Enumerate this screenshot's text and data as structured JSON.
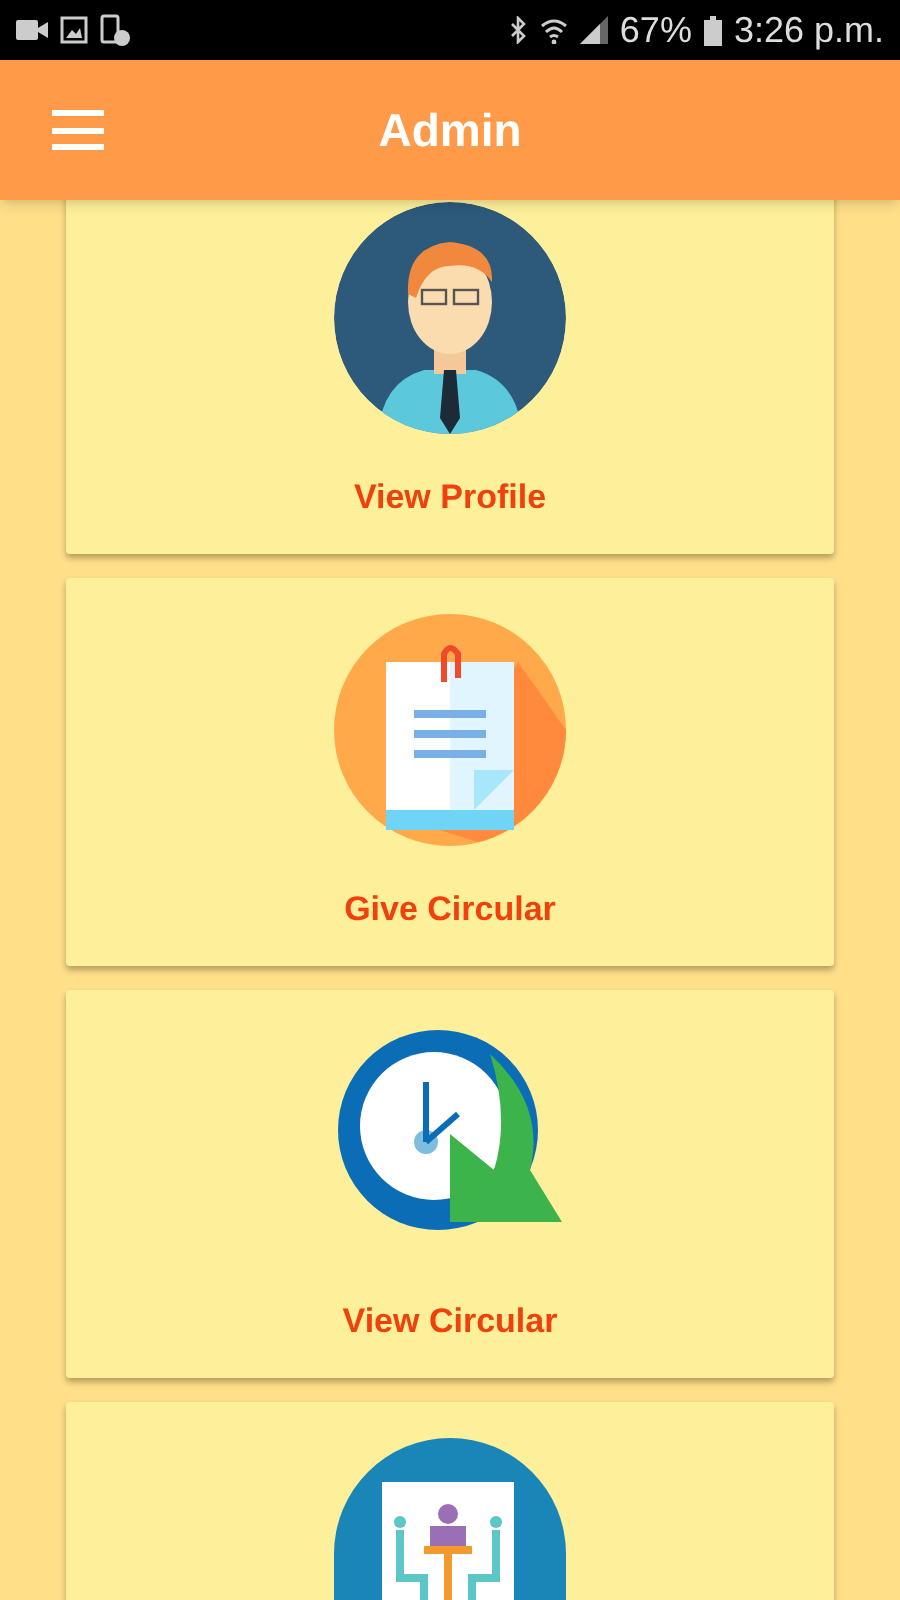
{
  "status_bar": {
    "battery": "67%",
    "time": "3:26 p.m."
  },
  "app_bar": {
    "title": "Admin"
  },
  "cards": [
    {
      "kind": "profile",
      "label": "View Profile"
    },
    {
      "kind": "document",
      "label": "Give Circular"
    },
    {
      "kind": "clock",
      "label": "View Circular"
    },
    {
      "kind": "meeting"
    }
  ]
}
